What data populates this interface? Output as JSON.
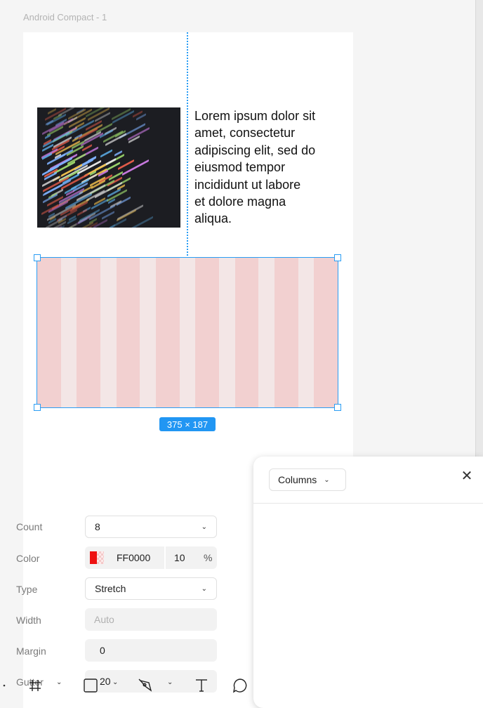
{
  "canvas": {
    "frame_label": "Android Compact - 1",
    "lorem_text": "Lorem ipsum dolor sit\namet, consectetur\nadipiscing elit, sed do\neiusmod tempor\nincididunt ut  labore\net dolore magna\naliqua.",
    "image_alt": "code-screenshot",
    "selection_size": "375 × 187",
    "grid_columns": 8,
    "colors": {
      "selection": "#2a9df4",
      "column_fill": "#f2d0d0",
      "gutter_fill": "#f3e6e6"
    }
  },
  "panel": {
    "grid_type": "Columns",
    "close_icon": "close-icon",
    "rows": {
      "count": {
        "label": "Count",
        "value": "8"
      },
      "color": {
        "label": "Color",
        "hex": "FF0000",
        "opacity": "10",
        "opacity_unit": "%"
      },
      "type": {
        "label": "Type",
        "value": "Stretch"
      },
      "width": {
        "label": "Width",
        "placeholder": "Auto"
      },
      "margin": {
        "label": "Margin",
        "value": "0"
      },
      "gutter": {
        "label": "Gutter",
        "value": "20"
      }
    }
  },
  "toolbar": {
    "tools": [
      "frame-tool-icon",
      "rectangle-tool-icon",
      "pen-tool-icon",
      "text-tool-icon",
      "comment-tool-icon"
    ]
  }
}
